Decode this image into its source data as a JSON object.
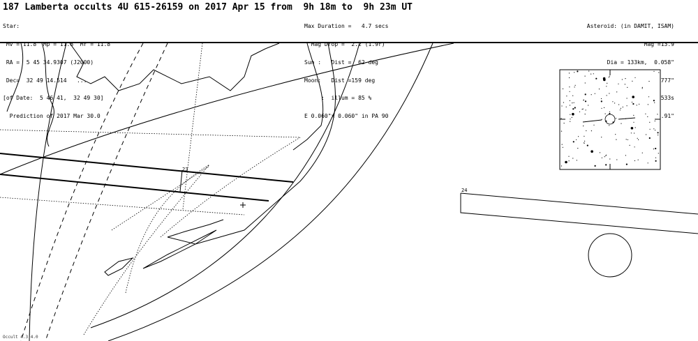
{
  "header": {
    "title": "187 Lamberta occults 4U 615-26159 on 2017 Apr 15 from  9h 18m to  9h 23m UT"
  },
  "star_info": [
    "Star:",
    " Mv = 11.8  Mp = 11.8  Mr = 11.8",
    " RA =  5 45 34.9307 (J2000)",
    " Dec=  32 49 14.514   ...",
    "[of Date:  5 46 41,  32 49 30]",
    "  Prediction of 2017 Mar 30.0"
  ],
  "event_info": [
    "Max Duration =   4.7 secs",
    "  Mag Drop =  2.2 (1.9r)",
    "Sun :   Dist =  62 deg",
    "Moon:   Dist =159 deg",
    "     :  illum = 85 %",
    "E 0.060\"x 0.060\" in PA 90"
  ],
  "asteroid_info": [
    "Asteroid: (in DAMIT, ISAM)",
    "Mag =13.9",
    "Dia = 133km,  0.058\"",
    "Parallax = 2.777\"",
    "Hourly dRA = 3.533s",
    "dDec = -3.91\""
  ],
  "map": {
    "time_labels": [
      "23",
      "24"
    ]
  },
  "footer": {
    "text": "Occult 4.3.4.0"
  }
}
